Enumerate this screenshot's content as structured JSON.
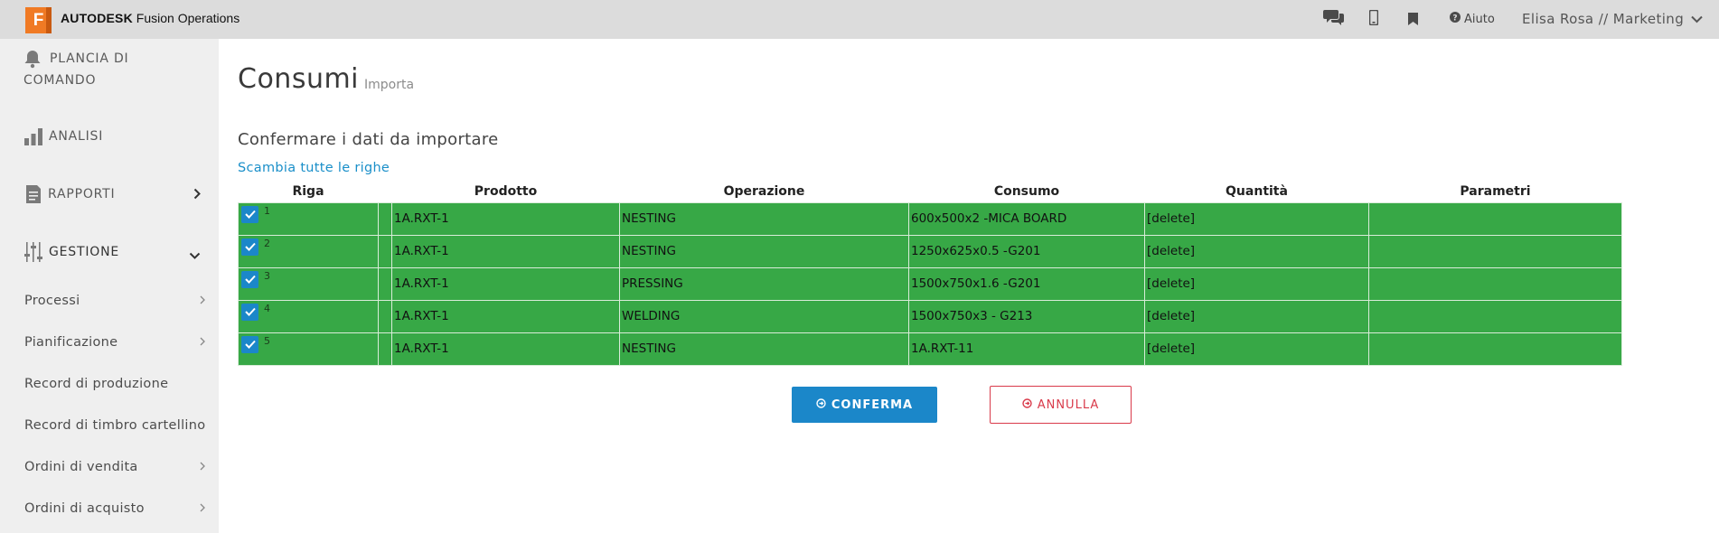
{
  "header": {
    "logo_letter": "F",
    "brand_bold": "AUTODESK",
    "brand_rest": "Fusion Operations",
    "help_label": "Aiuto",
    "user_label": "Elisa Rosa // Marketing"
  },
  "sidebar": {
    "main": [
      {
        "label_line1": "PLANCIA DI",
        "label_line2": "COMANDO",
        "icon": "bell-icon"
      },
      {
        "label": "ANALISI",
        "icon": "bar-chart-icon"
      },
      {
        "label": "RAPPORTI",
        "icon": "report-icon"
      },
      {
        "label": "GESTIONE",
        "icon": "sliders-icon"
      }
    ],
    "sub": [
      {
        "label": "Processi"
      },
      {
        "label": "Pianificazione"
      },
      {
        "label": "Record di produzione"
      },
      {
        "label": "Record di timbro cartellino"
      },
      {
        "label": "Ordini di vendita"
      },
      {
        "label": "Ordini di acquisto"
      }
    ]
  },
  "page": {
    "title": "Consumi",
    "subtitle": "Importa",
    "section_title": "Confermare i dati da importare",
    "swap_link": "Scambia tutte le righe"
  },
  "table": {
    "headers": [
      "Riga",
      "",
      "Prodotto",
      "Operazione",
      "Consumo",
      "Quantità",
      "Parametri"
    ],
    "rows": [
      {
        "n": "1",
        "prodotto": "1A.RXT-1",
        "operazione": "NESTING",
        "consumo": "600x500x2 -MICA BOARD",
        "quantita": "[delete]",
        "parametri": ""
      },
      {
        "n": "2",
        "prodotto": "1A.RXT-1",
        "operazione": "NESTING",
        "consumo": "1250x625x0.5 -G201",
        "quantita": "[delete]",
        "parametri": ""
      },
      {
        "n": "3",
        "prodotto": "1A.RXT-1",
        "operazione": "PRESSING",
        "consumo": "1500x750x1.6 -G201",
        "quantita": "[delete]",
        "parametri": ""
      },
      {
        "n": "4",
        "prodotto": "1A.RXT-1",
        "operazione": "WELDING",
        "consumo": "1500x750x3 - G213",
        "quantita": "[delete]",
        "parametri": ""
      },
      {
        "n": "5",
        "prodotto": "1A.RXT-1",
        "operazione": "NESTING",
        "consumo": "1A.RXT-11",
        "quantita": "[delete]",
        "parametri": ""
      }
    ]
  },
  "actions": {
    "confirm": "CONFERMA",
    "cancel": "ANNULLA"
  },
  "colors": {
    "row_bg": "#37a846",
    "accent": "#1b87c9",
    "danger": "#d93a4a",
    "logo": "#f07a24"
  }
}
